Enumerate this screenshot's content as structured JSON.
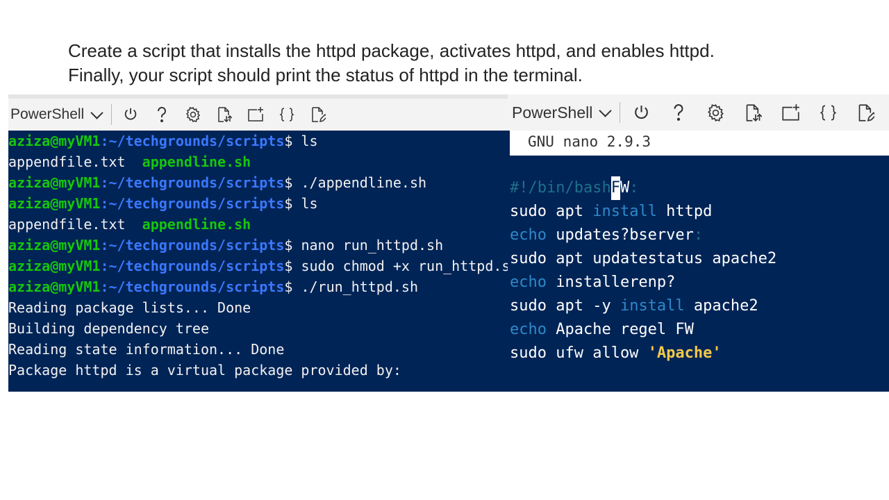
{
  "instructions": {
    "line1": "Create a script that installs the httpd package, activates httpd, and enables httpd.",
    "line2": "Finally, your script should print the status of httpd in the terminal."
  },
  "left_panel": {
    "shell_label": "PowerShell",
    "toolbar_icons": [
      "power-icon",
      "help-icon",
      "settings-icon",
      "upload-download-icon",
      "new-session-icon",
      "braces-icon",
      "open-editor-icon"
    ],
    "lines": [
      {
        "user": "aziza@myVM1",
        "path": ":~/techgrounds/scripts",
        "cmd": "$ ls"
      },
      {
        "text": "appendfile.txt  ",
        "green": "appendline.sh"
      },
      {
        "user": "aziza@myVM1",
        "path": ":~/techgrounds/scripts",
        "cmd": "$ ./appendline.sh"
      },
      {
        "user": "aziza@myVM1",
        "path": ":~/techgrounds/scripts",
        "cmd": "$ ls"
      },
      {
        "text": "appendfile.txt  ",
        "green": "appendline.sh"
      },
      {
        "user": "aziza@myVM1",
        "path": ":~/techgrounds/scripts",
        "cmd": "$ nano run_httpd.sh"
      },
      {
        "user": "aziza@myVM1",
        "path": ":~/techgrounds/scripts",
        "cmd": "$ sudo chmod +x run_httpd.sh"
      },
      {
        "user": "aziza@myVM1",
        "path": ":~/techgrounds/scripts",
        "cmd": "$ ./run_httpd.sh"
      },
      {
        "text": "Reading package lists... Done"
      },
      {
        "text": "Building dependency tree"
      },
      {
        "text": "Reading state information... Done"
      },
      {
        "text": "Package httpd is a virtual package provided by:"
      }
    ]
  },
  "right_panel": {
    "shell_label": "PowerShell",
    "nano_header": "GNU nano 2.9.3",
    "code": {
      "l1_comment": "#!/bin/bash",
      "l1_cursor": "F",
      "l1_rest": "W",
      "l1_colon": ":",
      "l2_a": "sudo apt ",
      "l2_kw": "install",
      "l2_b": " httpd",
      "l3_kw": "echo",
      "l3_b": " updates?bserver",
      "l3_colon": ":",
      "l4": "sudo apt updatestatus apache2",
      "l5_kw": "echo",
      "l5_b": " installerenp?",
      "l6_a": "sudo apt -y ",
      "l6_kw": "install",
      "l6_b": " apache2",
      "l7_kw": "echo",
      "l7_b": " Apache regel FW",
      "l8_a": "sudo ufw allow ",
      "l8_str": "'Apache'"
    }
  },
  "colors": {
    "terminal_bg": "#012456",
    "user_green": "#16c60c",
    "path_blue": "#3b78ff",
    "keyword_blue": "#2e89c9",
    "string_yellow": "#f1c94a"
  }
}
